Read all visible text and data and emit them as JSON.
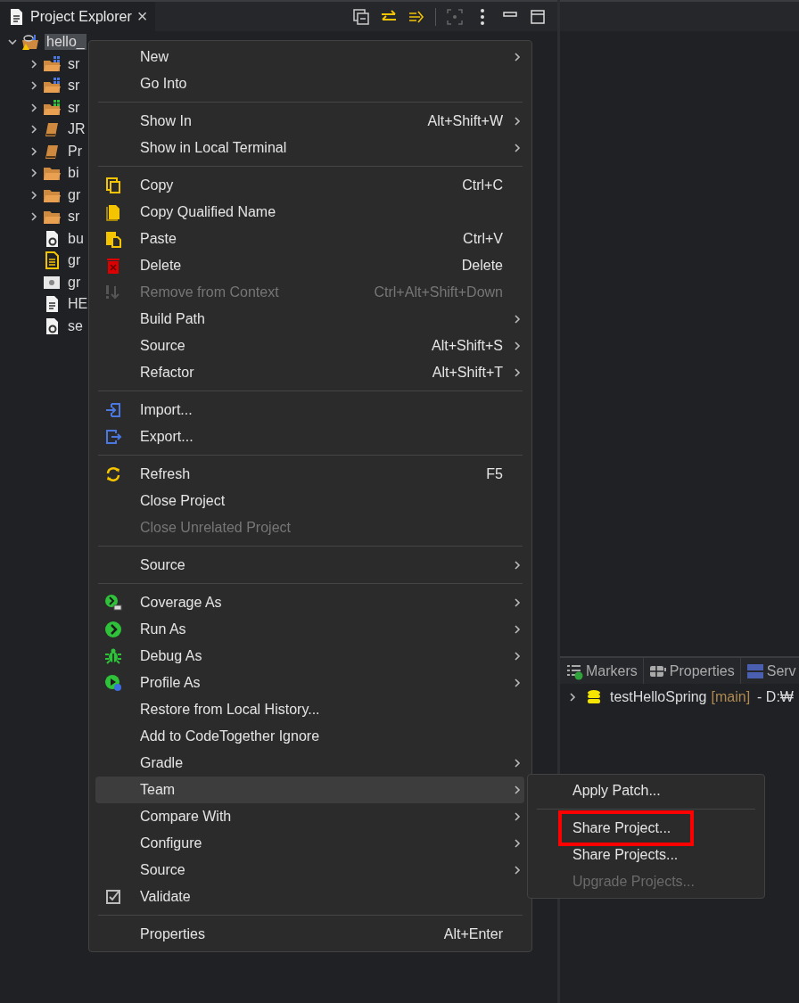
{
  "explorer": {
    "tab": {
      "title": "Project Explorer",
      "close": "×"
    },
    "tree": [
      {
        "label": "hello_",
        "kind": "project",
        "expanded": true,
        "selected": true,
        "children": [
          {
            "label": "sr",
            "kind": "package-folder",
            "expanded": false,
            "selected": false
          },
          {
            "label": "sr",
            "kind": "package-folder",
            "expanded": false,
            "selected": false
          },
          {
            "label": "sr",
            "kind": "resource-folder",
            "expanded": false,
            "selected": false
          },
          {
            "label": "JR",
            "kind": "library",
            "expanded": false,
            "selected": false
          },
          {
            "label": "Pr",
            "kind": "library",
            "expanded": false,
            "selected": false
          },
          {
            "label": "bi",
            "kind": "folder",
            "expanded": false,
            "selected": false
          },
          {
            "label": "gr",
            "kind": "folder",
            "expanded": false,
            "selected": false
          },
          {
            "label": "sr",
            "kind": "folder",
            "expanded": false,
            "selected": false
          },
          {
            "label": "bu",
            "kind": "gradle-file",
            "selected": false
          },
          {
            "label": "gr",
            "kind": "text-file",
            "selected": false
          },
          {
            "label": "gr",
            "kind": "settings-file",
            "selected": false
          },
          {
            "label": "HE",
            "kind": "doc-file",
            "selected": false
          },
          {
            "label": "se",
            "kind": "gradle-file",
            "selected": false
          }
        ]
      }
    ]
  },
  "context_menu": {
    "items": [
      {
        "kind": "plain",
        "label": "New",
        "has_submenu": true,
        "disabled": false,
        "selected": false
      },
      {
        "kind": "plain",
        "label": "Go Into",
        "has_submenu": false,
        "disabled": false,
        "selected": false
      },
      {
        "kind": "separator"
      },
      {
        "kind": "plain",
        "label": "Show In",
        "shortcut": "Alt+Shift+W",
        "has_submenu": true,
        "disabled": false,
        "selected": false
      },
      {
        "kind": "plain",
        "label": "Show in Local Terminal",
        "has_submenu": true,
        "disabled": false,
        "selected": false
      },
      {
        "kind": "separator"
      },
      {
        "kind": "copy",
        "label": "Copy",
        "shortcut": "Ctrl+C",
        "has_submenu": false,
        "disabled": false,
        "selected": false
      },
      {
        "kind": "copy-name",
        "label": "Copy Qualified Name",
        "has_submenu": false,
        "disabled": false,
        "selected": false
      },
      {
        "kind": "paste",
        "label": "Paste",
        "shortcut": "Ctrl+V",
        "has_submenu": false,
        "disabled": false,
        "selected": false
      },
      {
        "kind": "delete",
        "label": "Delete",
        "shortcut": "Delete",
        "has_submenu": false,
        "disabled": false,
        "selected": false
      },
      {
        "kind": "remove",
        "label": "Remove from Context",
        "shortcut": "Ctrl+Alt+Shift+Down",
        "has_submenu": false,
        "disabled": true,
        "selected": false
      },
      {
        "kind": "plain",
        "label": "Build Path",
        "has_submenu": true,
        "disabled": false,
        "selected": false
      },
      {
        "kind": "plain",
        "label": "Source",
        "shortcut": "Alt+Shift+S",
        "has_submenu": true,
        "disabled": false,
        "selected": false
      },
      {
        "kind": "plain",
        "label": "Refactor",
        "shortcut": "Alt+Shift+T",
        "has_submenu": true,
        "disabled": false,
        "selected": false
      },
      {
        "kind": "separator"
      },
      {
        "kind": "import",
        "label": "Import...",
        "has_submenu": false,
        "disabled": false,
        "selected": false
      },
      {
        "kind": "export",
        "label": "Export...",
        "has_submenu": false,
        "disabled": false,
        "selected": false
      },
      {
        "kind": "separator"
      },
      {
        "kind": "refresh",
        "label": "Refresh",
        "shortcut": "F5",
        "has_submenu": false,
        "disabled": false,
        "selected": false
      },
      {
        "kind": "plain",
        "label": "Close Project",
        "has_submenu": false,
        "disabled": false,
        "selected": false
      },
      {
        "kind": "plain",
        "label": "Close Unrelated Project",
        "has_submenu": false,
        "disabled": true,
        "selected": false
      },
      {
        "kind": "separator"
      },
      {
        "kind": "plain",
        "label": "Source",
        "has_submenu": true,
        "disabled": false,
        "selected": false
      },
      {
        "kind": "separator"
      },
      {
        "kind": "coverage",
        "label": "Coverage As",
        "has_submenu": true,
        "disabled": false,
        "selected": false
      },
      {
        "kind": "run",
        "label": "Run As",
        "has_submenu": true,
        "disabled": false,
        "selected": false
      },
      {
        "kind": "debug",
        "label": "Debug As",
        "has_submenu": true,
        "disabled": false,
        "selected": false
      },
      {
        "kind": "profile",
        "label": "Profile As",
        "has_submenu": true,
        "disabled": false,
        "selected": false
      },
      {
        "kind": "plain",
        "label": "Restore from Local History...",
        "has_submenu": false,
        "disabled": false,
        "selected": false
      },
      {
        "kind": "plain",
        "label": "Add to CodeTogether Ignore",
        "has_submenu": false,
        "disabled": false,
        "selected": false
      },
      {
        "kind": "plain",
        "label": "Gradle",
        "has_submenu": true,
        "disabled": false,
        "selected": false
      },
      {
        "kind": "plain",
        "label": "Team",
        "has_submenu": true,
        "disabled": false,
        "selected": true
      },
      {
        "kind": "plain",
        "label": "Compare With",
        "has_submenu": true,
        "disabled": false,
        "selected": false
      },
      {
        "kind": "plain",
        "label": "Configure",
        "has_submenu": true,
        "disabled": false,
        "selected": false
      },
      {
        "kind": "plain",
        "label": "Source",
        "has_submenu": true,
        "disabled": false,
        "selected": false
      },
      {
        "kind": "validate",
        "label": "Validate",
        "has_submenu": false,
        "disabled": false,
        "selected": false
      },
      {
        "kind": "separator"
      },
      {
        "kind": "plain",
        "label": "Properties",
        "shortcut": "Alt+Enter",
        "has_submenu": false,
        "disabled": false,
        "selected": false
      }
    ]
  },
  "team_submenu": {
    "items": [
      {
        "kind": "item",
        "label": "Apply Patch...",
        "disabled": false,
        "highlighted": false
      },
      {
        "kind": "separator"
      },
      {
        "kind": "item",
        "label": "Share Project...",
        "disabled": false,
        "highlighted": true
      },
      {
        "kind": "item",
        "label": "Share Projects...",
        "disabled": false,
        "highlighted": false
      },
      {
        "kind": "item",
        "label": "Upgrade Projects...",
        "disabled": true,
        "highlighted": false
      }
    ]
  },
  "bottom_panel": {
    "tabs": [
      {
        "label": "Markers",
        "selected": false
      },
      {
        "label": "Properties",
        "selected": false
      },
      {
        "label": "Serv",
        "selected": false
      }
    ],
    "rows": [
      {
        "name": "testHelloSpring",
        "branch": "[main]",
        "path": "- D:₩",
        "expanded": false
      }
    ]
  }
}
